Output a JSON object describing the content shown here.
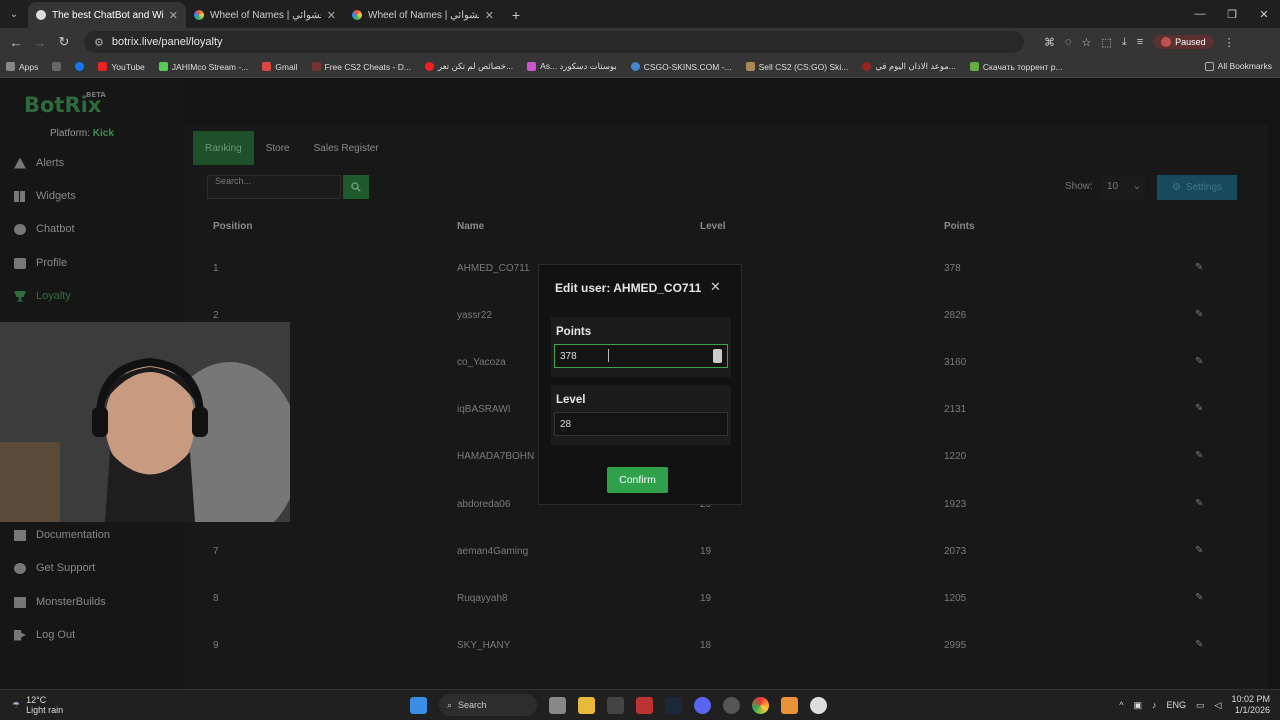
{
  "browser": {
    "tabs": [
      {
        "title": "The best ChatBot and Widgets",
        "active": true
      },
      {
        "title": "Wheel of Names | اسم العشوائي",
        "active": false
      },
      {
        "title": "Wheel of Names | اسم العشوائي",
        "active": false
      }
    ],
    "url": "botrix.live/panel/loyalty",
    "profile_label": "Paused",
    "bookmarks": [
      "Apps",
      "YouTube",
      "JAHIMco Stream -...",
      "Gmail",
      "Free CS2 Cheats - D...",
      "خصائص لم تكن تعر...",
      "As... بوستات دسكورد",
      "CSGO-SKINS.COM -...",
      "Sell CS2 (CS:GO) Ski...",
      "موعد الاذان اليوم في...",
      "Скачать торрент р..."
    ],
    "all_bookmarks": "All Bookmarks"
  },
  "app": {
    "logo": "BotRix",
    "logo_badge": "BETA",
    "platform_label": "Platform:",
    "platform_value": "Kick",
    "nav": [
      {
        "label": "Alerts",
        "icon": "warning-icon"
      },
      {
        "label": "Widgets",
        "icon": "grid-icon"
      },
      {
        "label": "Chatbot",
        "icon": "palette-icon"
      },
      {
        "label": "Profile",
        "icon": "profile-card-icon"
      },
      {
        "label": "Loyalty",
        "icon": "trophy-icon"
      }
    ],
    "nav_bottom": [
      {
        "label": "Documentation",
        "icon": "book-icon"
      },
      {
        "label": "Get Support",
        "icon": "support-icon"
      },
      {
        "label": "MonsterBuilds",
        "icon": "monitor-icon"
      },
      {
        "label": "Log Out",
        "icon": "logout-icon"
      }
    ]
  },
  "page": {
    "tabs": [
      "Ranking",
      "Store",
      "Sales Register"
    ],
    "search_placeholder": "Search...",
    "show_label": "Show:",
    "show_value": "10",
    "settings_label": "Settings",
    "columns": [
      "Position",
      "Name",
      "Level",
      "Points"
    ],
    "rows": [
      {
        "position": "1",
        "name": "AHMED_CO711",
        "level": "",
        "points": "378"
      },
      {
        "position": "2",
        "name": "yassr22",
        "level": "",
        "points": "2826"
      },
      {
        "position": "",
        "name": "co_Yacoza",
        "level": "",
        "points": "3160"
      },
      {
        "position": "",
        "name": "iqBASRAWI",
        "level": "",
        "points": "2131"
      },
      {
        "position": "",
        "name": "HAMADA7BOHN",
        "level": "",
        "points": "1220"
      },
      {
        "position": "",
        "name": "abdoreda06",
        "level": "20",
        "points": "1923"
      },
      {
        "position": "7",
        "name": "aeman4Gaming",
        "level": "19",
        "points": "2073"
      },
      {
        "position": "8",
        "name": "Ruqayyah8",
        "level": "19",
        "points": "1205"
      },
      {
        "position": "9",
        "name": "SKY_HANY",
        "level": "18",
        "points": "2995"
      }
    ]
  },
  "modal": {
    "title": "Edit user: AHMED_CO711",
    "points_label": "Points",
    "points_value": "378",
    "level_label": "Level",
    "level_value": "28",
    "confirm_label": "Confirm"
  },
  "taskbar": {
    "temp": "12°C",
    "weather": "Light rain",
    "search": "Search",
    "lang": "ENG",
    "time": "10:02 PM",
    "date": "1/1/2026"
  },
  "colors": {
    "accent": "#2fa14b",
    "loyalty_active": "#2f6d3c",
    "settings": "#164a5c"
  }
}
